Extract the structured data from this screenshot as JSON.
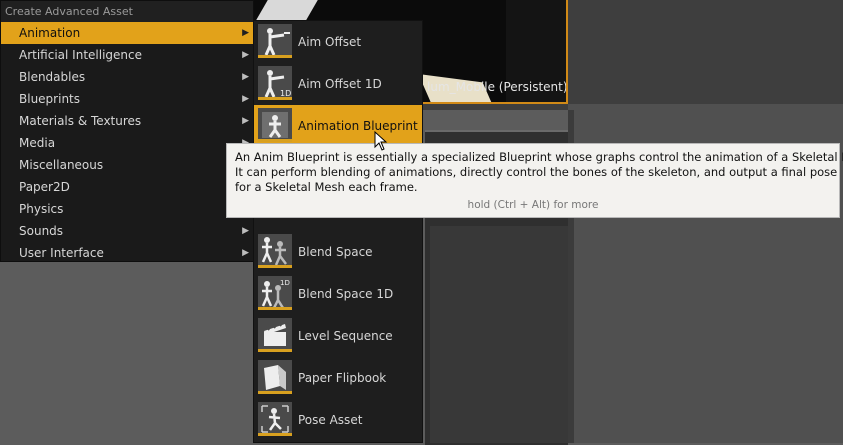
{
  "menu": {
    "header": "Create Advanced Asset",
    "items": [
      {
        "label": "Animation",
        "active": true
      },
      {
        "label": "Artificial Intelligence",
        "active": false
      },
      {
        "label": "Blendables",
        "active": false
      },
      {
        "label": "Blueprints",
        "active": false
      },
      {
        "label": "Materials & Textures",
        "active": false
      },
      {
        "label": "Media",
        "active": false
      },
      {
        "label": "Miscellaneous",
        "active": false
      },
      {
        "label": "Paper2D",
        "active": false
      },
      {
        "label": "Physics",
        "active": false
      },
      {
        "label": "Sounds",
        "active": false
      },
      {
        "label": "User Interface",
        "active": false
      }
    ],
    "arrow_glyph": "▶"
  },
  "submenu": {
    "items": [
      {
        "label": "Aim Offset",
        "icon": "aim-offset-icon"
      },
      {
        "label": "Aim Offset 1D",
        "icon": "aim-offset-1d-icon"
      },
      {
        "label": "Animation Blueprint",
        "icon": "animation-blueprint-icon",
        "active": true
      },
      {
        "label": "Blend Space",
        "icon": "blend-space-icon"
      },
      {
        "label": "Blend Space 1D",
        "icon": "blend-space-1d-icon"
      },
      {
        "label": "Level Sequence",
        "icon": "clapperboard-icon"
      },
      {
        "label": "Paper Flipbook",
        "icon": "flipbook-icon"
      },
      {
        "label": "Pose Asset",
        "icon": "pose-asset-icon"
      }
    ],
    "badge_1d": "1D"
  },
  "tooltip": {
    "lines": [
      "An Anim Blueprint is essentially a specialized Blueprint whose graphs control the animation of a Skeletal Mesh.",
      "It can perform blending of animations, directly control the bones of the skeleton, and output a final pose",
      "for a Skeletal Mesh each frame."
    ],
    "hint": "hold (Ctrl + Alt) for more"
  },
  "viewport": {
    "level_text": "lum_Mobile (Persistent)"
  },
  "colors": {
    "accent": "#e2a21a",
    "menu_bg": "#1a1a1a",
    "tooltip_bg": "#f3f2ef"
  }
}
